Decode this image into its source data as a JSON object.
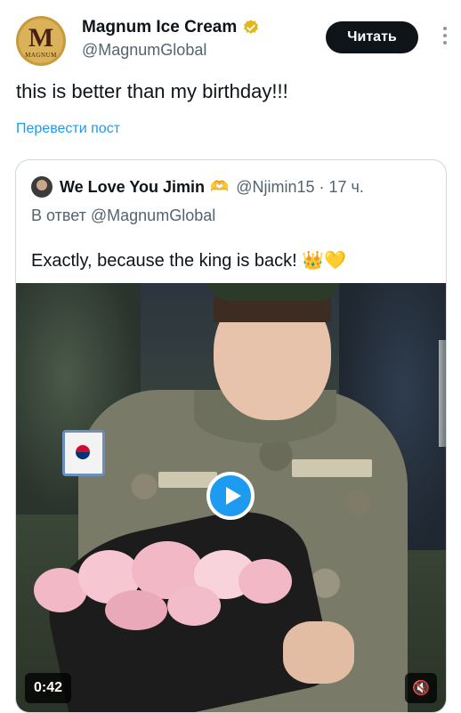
{
  "author": {
    "display_name": "Magnum Ice Cream",
    "handle": "@MagnumGlobal",
    "avatar_letter": "M",
    "avatar_sub": "MAGNUM",
    "verified_color": "#e2b719"
  },
  "follow_label": "Читать",
  "tweet_text": "this is better than my birthday!!!",
  "translate_label": "Перевести пост",
  "quote": {
    "display_name": "We Love You Jimin",
    "name_emoji": "🫶",
    "handle_time": "@Njimin15 · 17 ч.",
    "reply_to": "В ответ @MagnumGlobal",
    "text": "Exactly, because the king is back!",
    "text_emoji": "👑💛"
  },
  "video": {
    "duration": "0:42",
    "mute_icon": "🔇"
  },
  "colors": {
    "accent": "#1d9bf0",
    "secondary_text": "#536471",
    "follow_bg": "#0f1419"
  }
}
